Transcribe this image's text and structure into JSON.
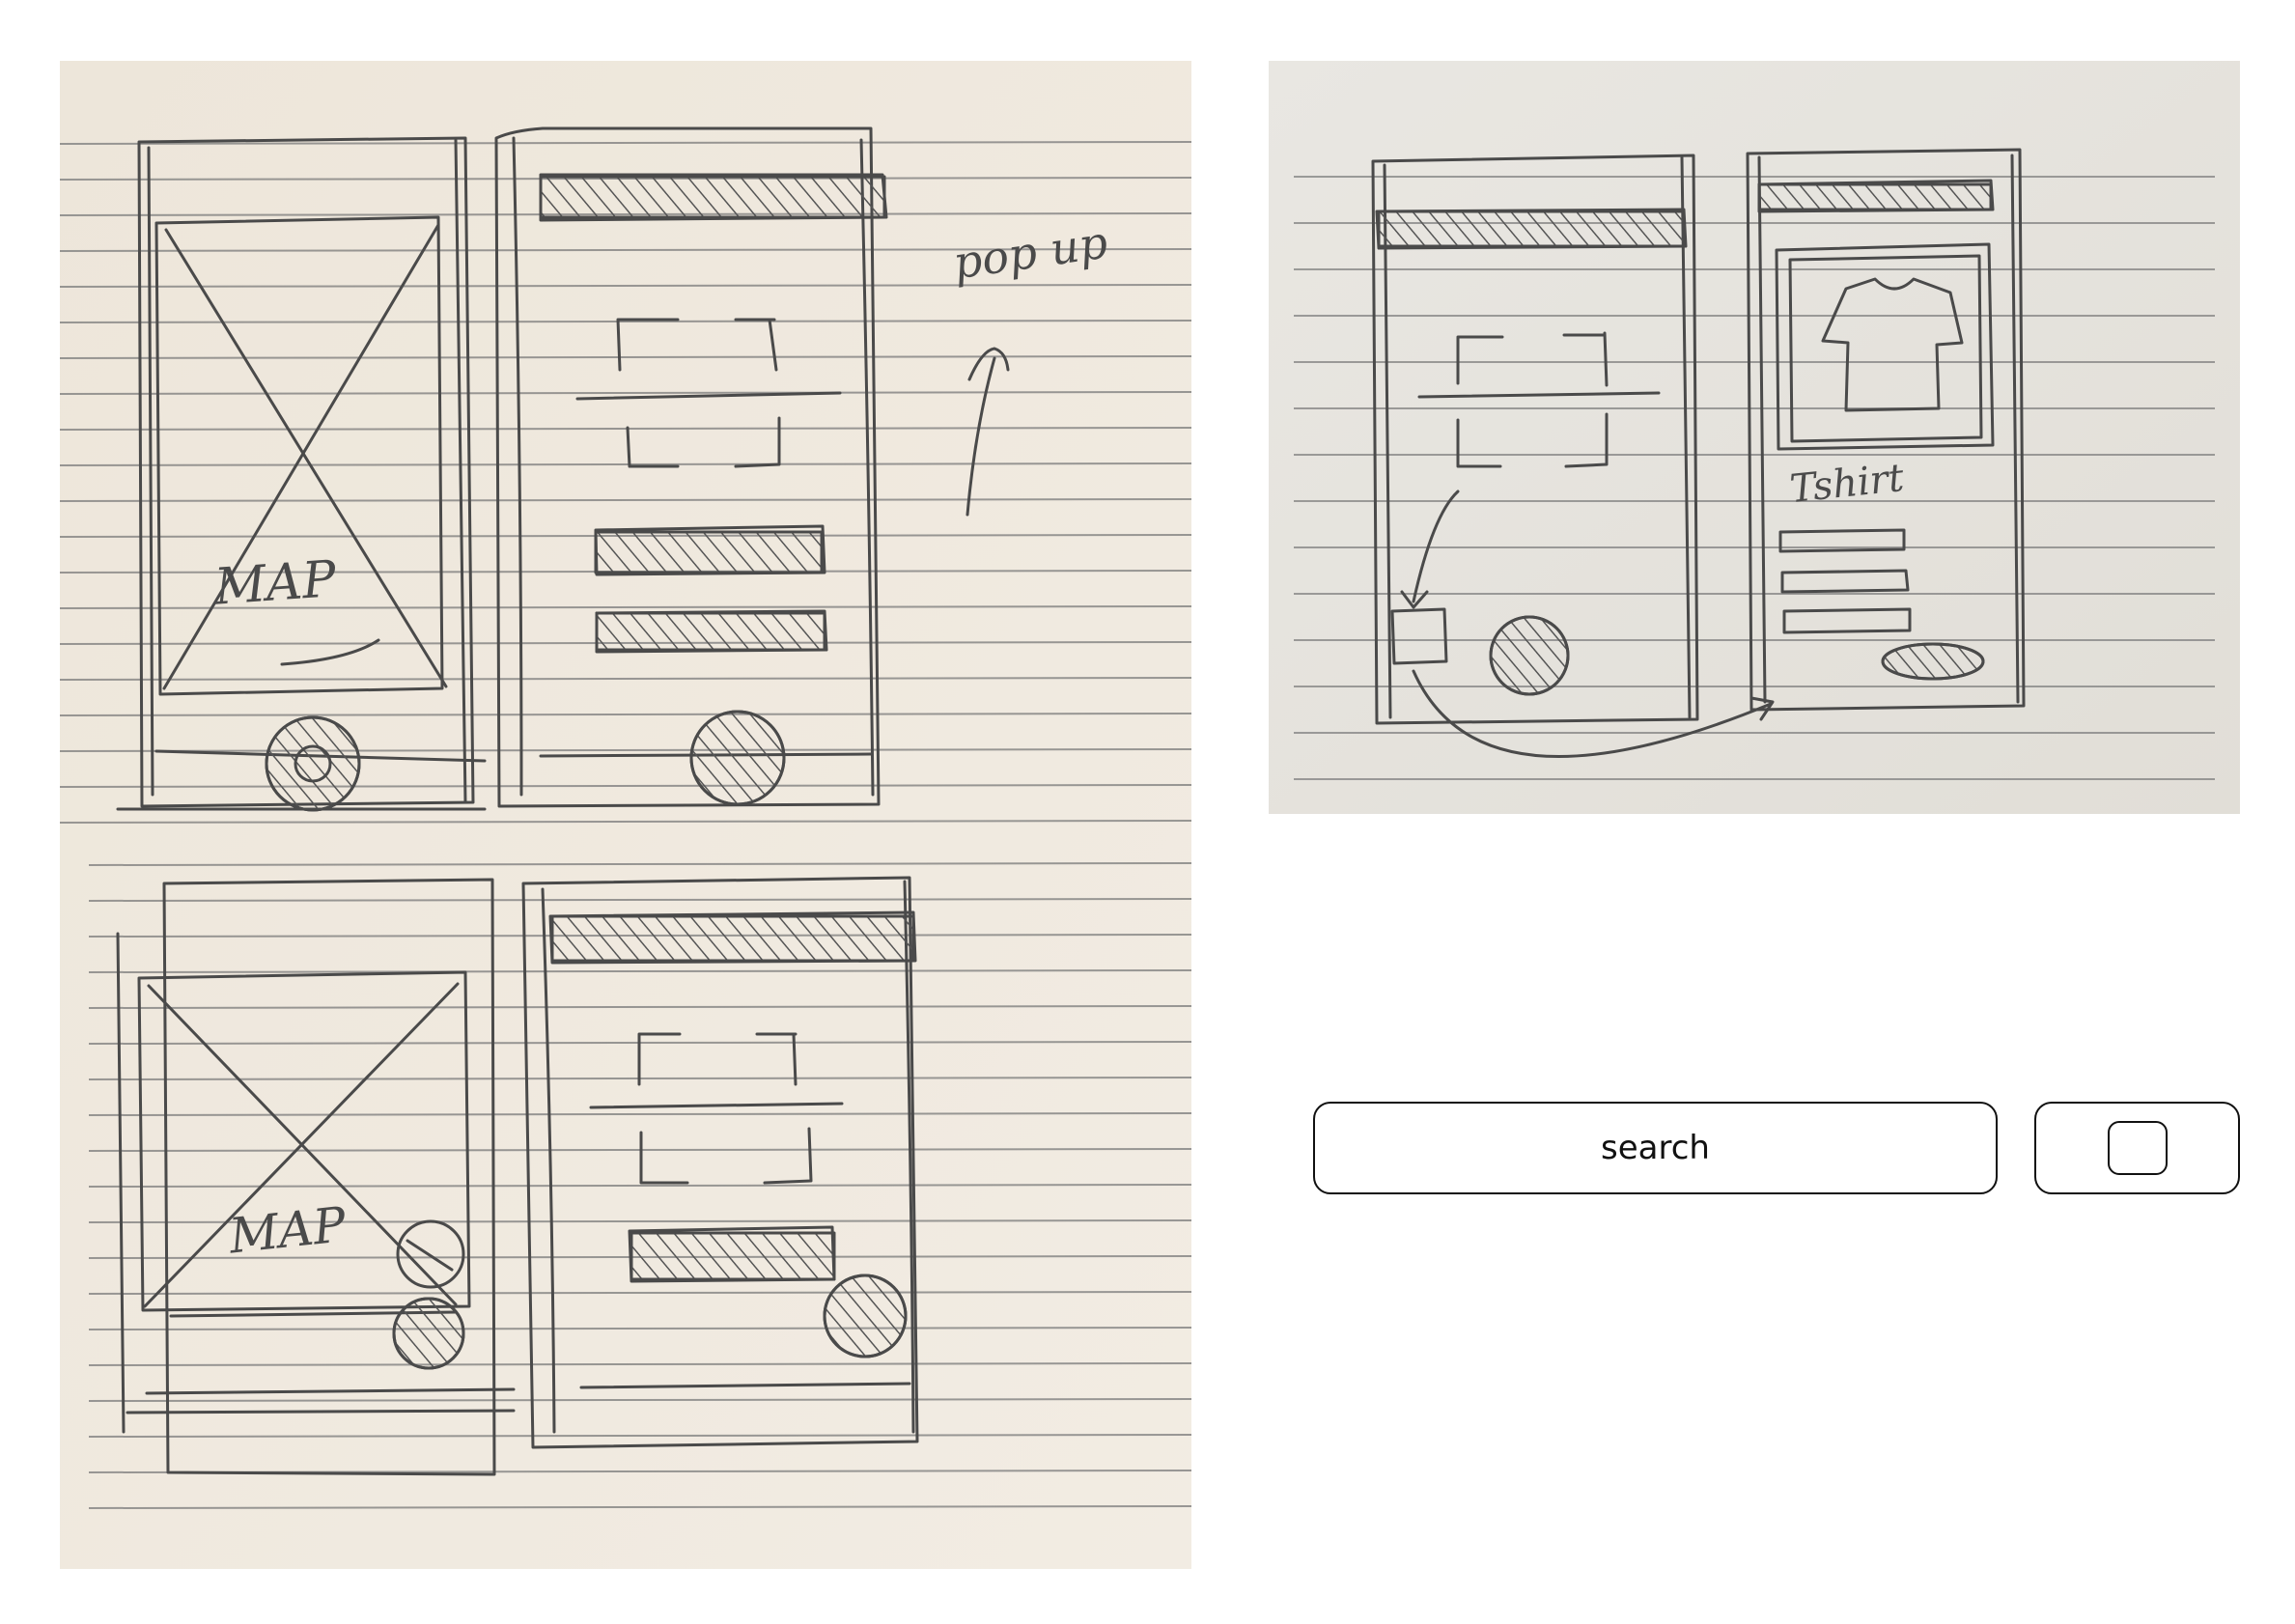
{
  "sketch_left": {
    "label_map_top": "MAP",
    "label_popup": "pop up",
    "label_map_bottom": "MAP"
  },
  "sketch_right": {
    "label_tshirt": "Tshirt"
  },
  "controls": {
    "search_label": "search"
  }
}
